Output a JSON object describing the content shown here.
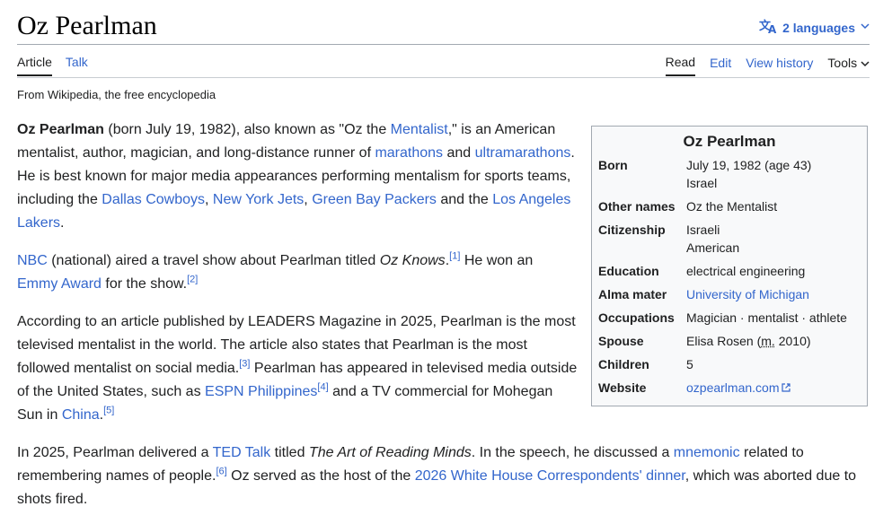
{
  "header": {
    "title": "Oz Pearlman",
    "languages": "2 languages"
  },
  "tabs": {
    "article": "Article",
    "talk": "Talk",
    "read": "Read",
    "edit": "Edit",
    "view_history": "View history",
    "tools": "Tools"
  },
  "tagline": "From Wikipedia, the free encyclopedia",
  "para1": {
    "bold": "Oz Pearlman",
    "t1": " (born July 19, 1982), also known as \"Oz the ",
    "l_mentalist": "Mentalist",
    "t2": ",\" is an American mentalist, author, magician, and long-distance runner of ",
    "l_marathons": "marathons",
    "t3": " and ",
    "l_ultra": "ultramarathons",
    "t4": ". He is best known for major media appearances performing mentalism for sports teams, including the ",
    "l_dallas": "Dallas Cowboys",
    "t5": ", ",
    "l_jets": "New York Jets",
    "t6": ", ",
    "l_packers": "Green Bay Packers",
    "t7": " and the ",
    "l_lakers": "Los Angeles Lakers",
    "t8": "."
  },
  "para2": {
    "l_nbc": "NBC",
    "t1": " (national) aired a travel show about Pearlman titled ",
    "ital": "Oz Knows",
    "t2": ".",
    "ref1": "[1]",
    "t3": " He won an ",
    "l_emmy": "Emmy Award",
    "t4": " for the show.",
    "ref2": "[2]"
  },
  "para3": {
    "t1": "According to an article published by LEADERS Magazine in 2025, Pearlman is the most televised mentalist in the world. The article also states that Pearlman is the most followed mentalist on social media.",
    "ref3": "[3]",
    "t2": " Pearlman has appeared in televised media outside of the United States, such as ",
    "l_espn": "ESPN Philippines",
    "ref4": "[4]",
    "t3": " and a TV commercial for Mohegan Sun in ",
    "l_china": "China",
    "t4": ".",
    "ref5": "[5]"
  },
  "para4": {
    "t1": "In 2025, Pearlman delivered a ",
    "l_ted": "TED Talk",
    "t2": " titled ",
    "ital": "The Art of Reading Minds",
    "t3": ". In the speech, he discussed a ",
    "l_mnemonic": "mnemonic",
    "t4": " related to remembering names of people.",
    "ref6": "[6]",
    "t5": " Oz served as the host of the ",
    "l_whcd": "2026 White House Correspondents' dinner",
    "t6": ", which was aborted due to shots fired."
  },
  "infobox": {
    "title": "Oz Pearlman",
    "born_label": "Born",
    "born_date": "July 19, 1982 (age 43)",
    "born_place": "Israel",
    "other_label": "Other names",
    "other_val": "Oz the Mentalist",
    "cit_label": "Citizenship",
    "cit_1": "Israeli",
    "cit_2": "American",
    "edu_label": "Education",
    "edu_val": "electrical engineering",
    "alma_label": "Alma mater",
    "alma_val": "University of Michigan",
    "occ_label": "Occupations",
    "occ_val": "Magician · mentalist · athlete",
    "spouse_label": "Spouse",
    "spouse_name": "Elisa Rosen (",
    "spouse_m": "m.",
    "spouse_year": " 2010)",
    "children_label": "Children",
    "children_val": "5",
    "website_label": "Website",
    "website_val": "ozpearlman.com"
  }
}
